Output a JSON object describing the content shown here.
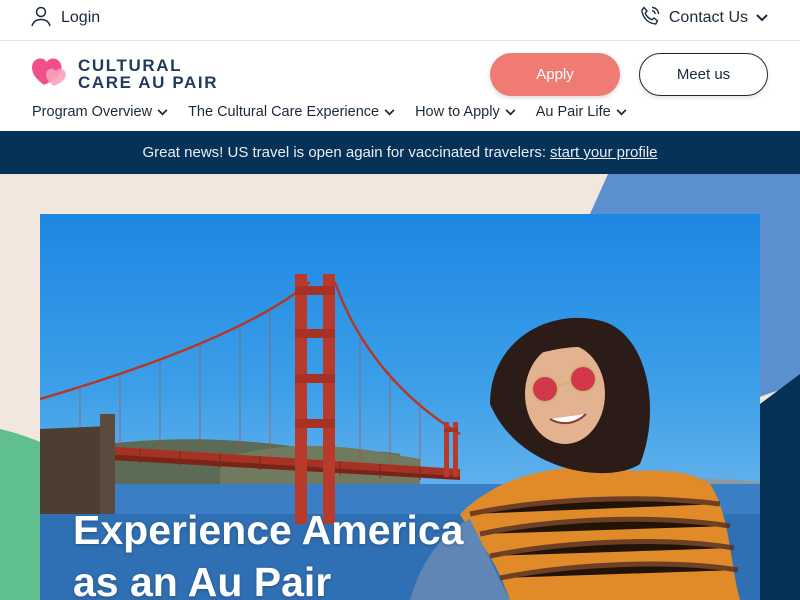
{
  "utility": {
    "login_label": "Login",
    "contact_label": "Contact Us"
  },
  "logo": {
    "line1": "CULTURAL",
    "line2": "CARE AU PAIR"
  },
  "buttons": {
    "apply": "Apply",
    "meet": "Meet us"
  },
  "nav": {
    "items": [
      {
        "label": "Program Overview"
      },
      {
        "label": "The Cultural Care Experience"
      },
      {
        "label": "How to Apply"
      },
      {
        "label": "Au Pair Life"
      }
    ]
  },
  "announcement": {
    "text": "Great news! US travel is open again for vaccinated travelers:",
    "link": "start your profile"
  },
  "hero": {
    "headline_line1": "Experience America",
    "headline_line2": "as an Au Pair"
  },
  "colors": {
    "accent": "#f07b73",
    "navy": "#073257",
    "cream": "#f1e7df",
    "blue_shape": "#5b8fd0",
    "green_shape": "#5fbf8f"
  },
  "icons": [
    "user-icon",
    "phone-icon",
    "chevron-down-icon",
    "heart-logo-icon"
  ]
}
